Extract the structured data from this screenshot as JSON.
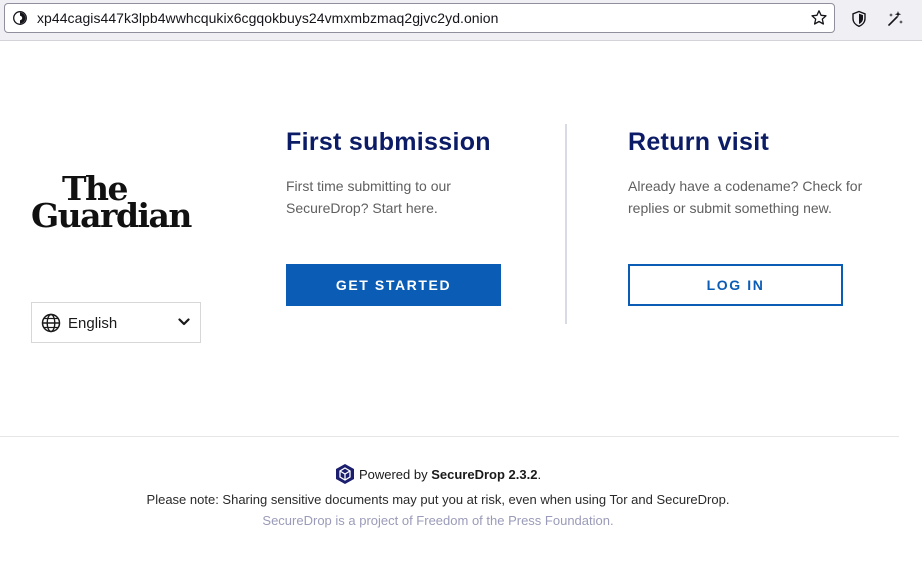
{
  "browser": {
    "url": "xp44cagis447k3lpb4wwhcqukix6cgqokbuys24vmxmbzmaq2gjvc2yd.onion",
    "icons": [
      "onion-icon",
      "star-icon",
      "shield-icon",
      "sparkle-icon"
    ]
  },
  "logo": {
    "line1": "The",
    "line2": "Guardian"
  },
  "language": {
    "selected": "English"
  },
  "first_submission": {
    "title": "First submission",
    "text": "First time submitting to our SecureDrop? Start here.",
    "button": "GET STARTED"
  },
  "return_visit": {
    "title": "Return visit",
    "text": "Already have a codename? Check for replies or submit something new.",
    "button": "LOG IN"
  },
  "footer": {
    "powered_prefix": "Powered by",
    "powered_name": "SecureDrop 2.3.2",
    "powered_suffix": ".",
    "note": "Please note: Sharing sensitive documents may put you at risk, even when using Tor and SecureDrop.",
    "fpf": "SecureDrop is a project of Freedom of the Press Foundation."
  },
  "colors": {
    "accent": "#0b5cb5",
    "title": "#0b1b66"
  }
}
